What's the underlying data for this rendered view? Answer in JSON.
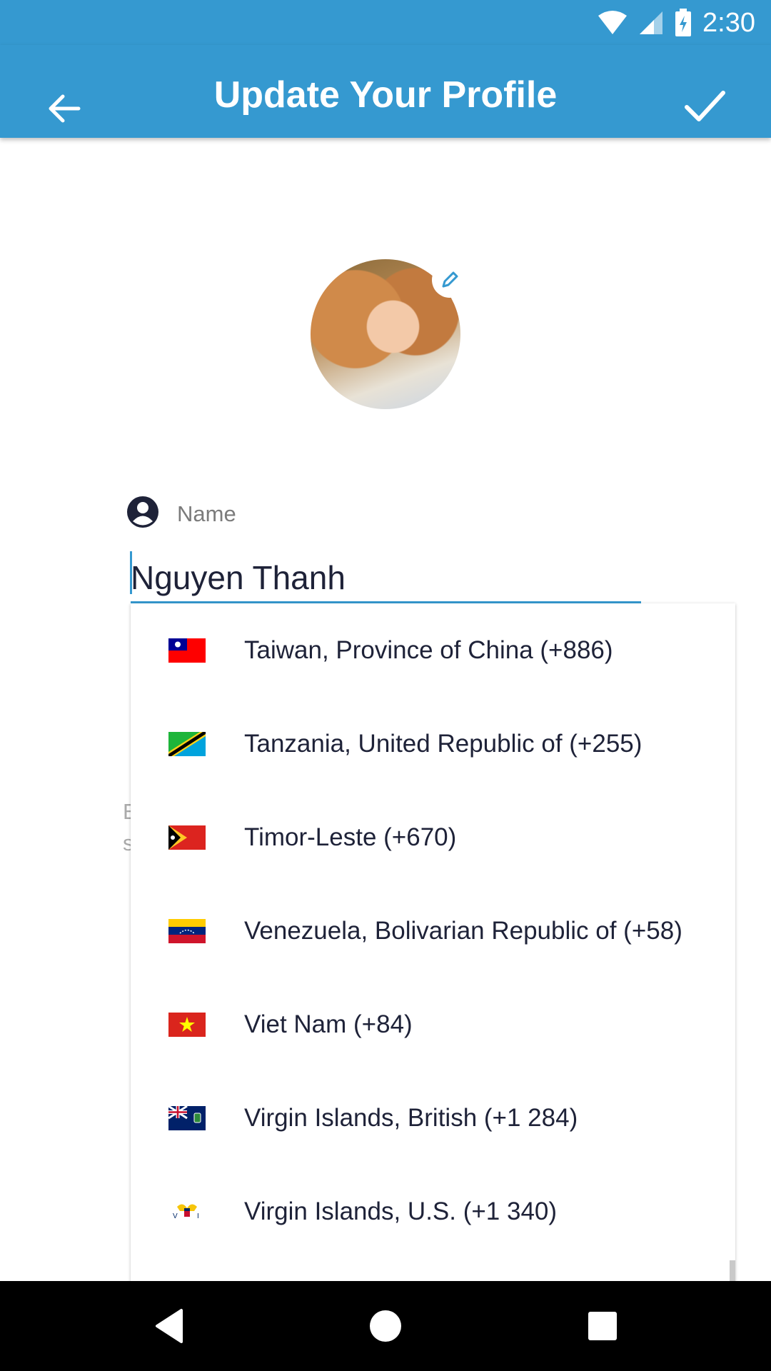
{
  "status": {
    "time": "2:30"
  },
  "app_bar": {
    "title": "Update Your Profile"
  },
  "profile": {
    "name_label": "Name",
    "name_value": "Nguyen Thanh"
  },
  "hidden_hint": {
    "line1": "E",
    "line2": "s"
  },
  "countries": [
    {
      "label": "Taiwan, Province of China (+886)",
      "flag": "taiwan-flag"
    },
    {
      "label": "Tanzania, United Republic of (+255)",
      "flag": "tanzania-flag"
    },
    {
      "label": "Timor-Leste (+670)",
      "flag": "timor-leste-flag"
    },
    {
      "label": "Venezuela, Bolivarian Republic of (+58)",
      "flag": "venezuela-flag"
    },
    {
      "label": "Viet Nam (+84)",
      "flag": "vietnam-flag"
    },
    {
      "label": "Virgin Islands, British (+1 284)",
      "flag": "bvi-flag"
    },
    {
      "label": "Virgin Islands, U.S. (+1 340)",
      "flag": "usvi-flag"
    }
  ],
  "colors": {
    "primary": "#3599d0",
    "text": "#1e2238"
  }
}
